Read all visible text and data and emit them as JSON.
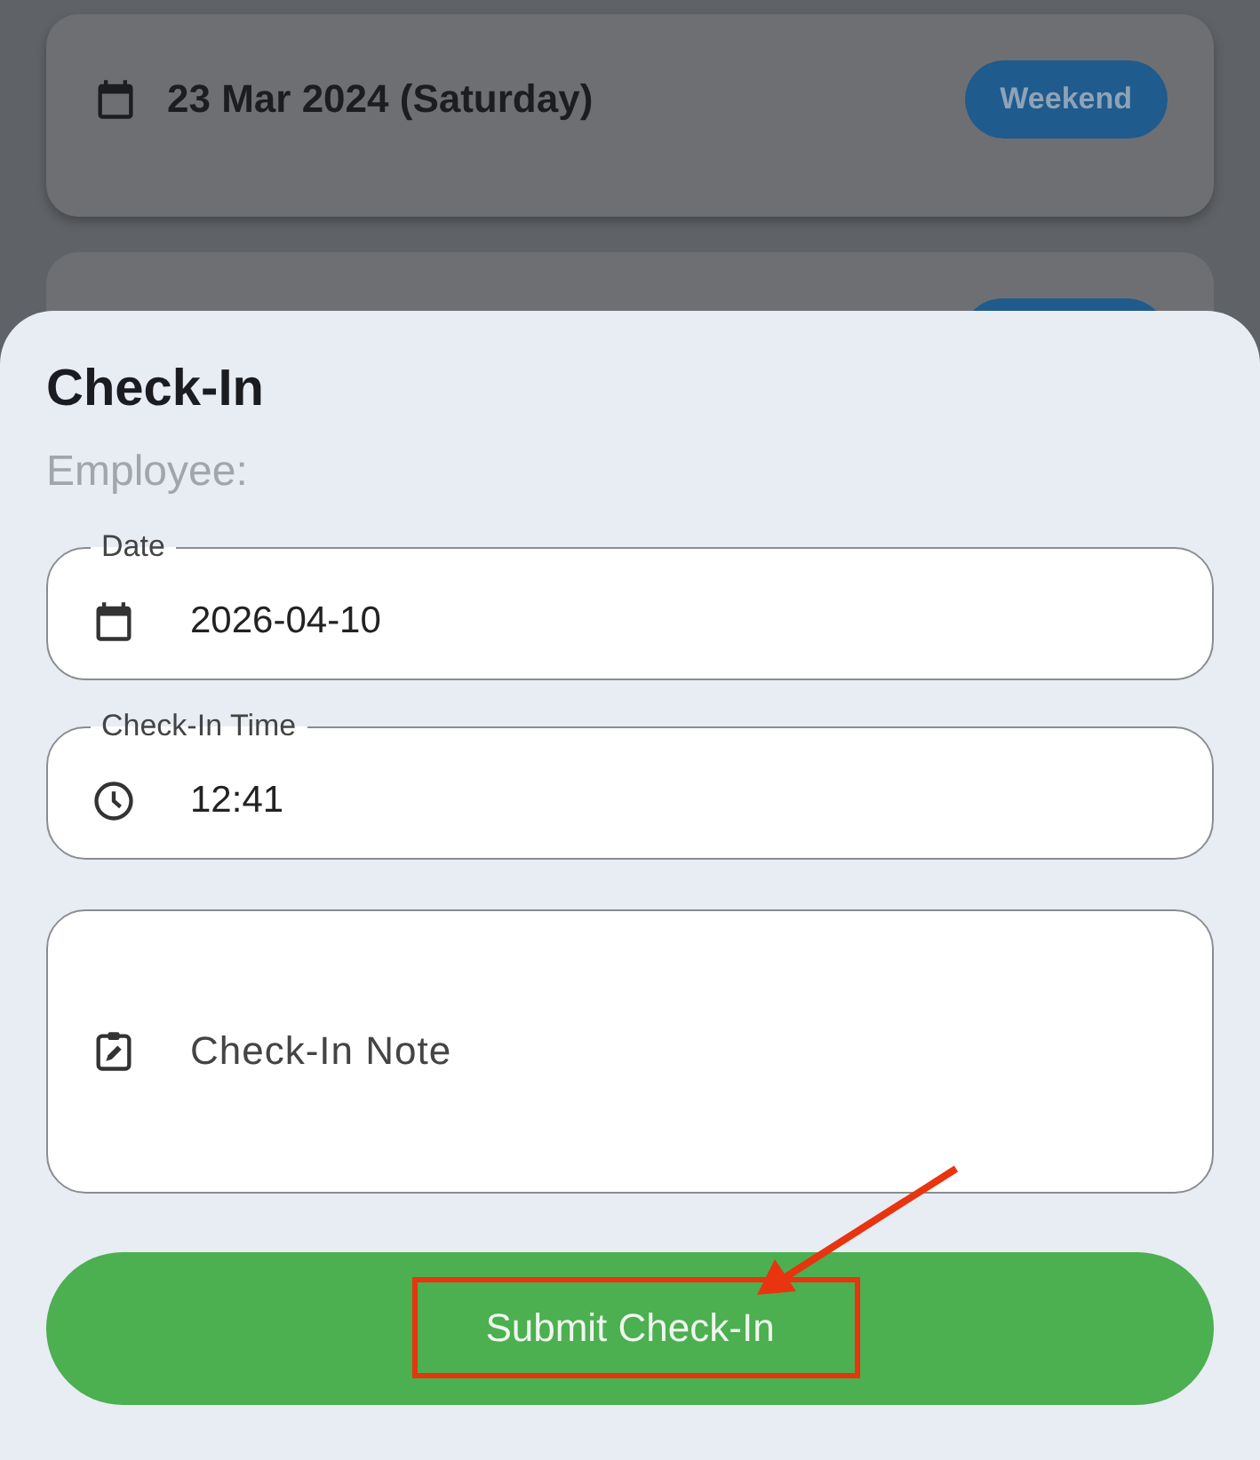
{
  "background_list": {
    "cards": [
      {
        "kind": "full",
        "date": "23 Mar 2024 (Saturday)",
        "badge": "Weekend"
      },
      {
        "kind": "partial"
      }
    ]
  },
  "sheet": {
    "title": "Check-In",
    "subtitle": "Employee:",
    "fields": [
      {
        "kind": "date",
        "label": "Date",
        "value": "2026-04-10"
      },
      {
        "kind": "time",
        "label": "Check-In Time",
        "value": "12:41"
      },
      {
        "kind": "note",
        "placeholder": "Check-In Note"
      }
    ],
    "submit_button": "Submit Check-In"
  },
  "annotation": {
    "highlight_box": true,
    "arrow": true
  }
}
